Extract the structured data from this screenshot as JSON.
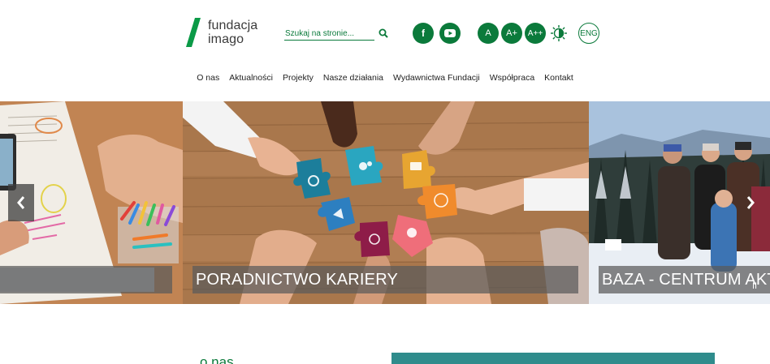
{
  "logo": {
    "line1": "fundacja",
    "line2": "imago"
  },
  "search": {
    "placeholder": "Szukaj na stronie...",
    "icon": "search-icon"
  },
  "social": {
    "facebook_label": "f",
    "youtube_icon": "youtube-icon"
  },
  "font_size": {
    "normal": "A",
    "large": "A+",
    "larger": "A++"
  },
  "contrast_icon": "contrast-icon",
  "language": "ENG",
  "nav": {
    "items": [
      "O nas",
      "Aktualności",
      "Projekty",
      "Nasze działania",
      "Wydawnictwa Fundacji",
      "Współpraca",
      "Kontakt"
    ]
  },
  "slider": {
    "slides": [
      {
        "caption": ""
      },
      {
        "caption": "PORADNICTWO KARIERY"
      },
      {
        "caption": "BAZA - CENTRUM AKTYWNOŚCI"
      }
    ],
    "prev_label": "‹",
    "next_label": "›",
    "pause_label": "II"
  },
  "about": {
    "title": "o nas"
  },
  "colors": {
    "brand": "#0b7a3b",
    "caption_bg": "#5a5a5a"
  }
}
